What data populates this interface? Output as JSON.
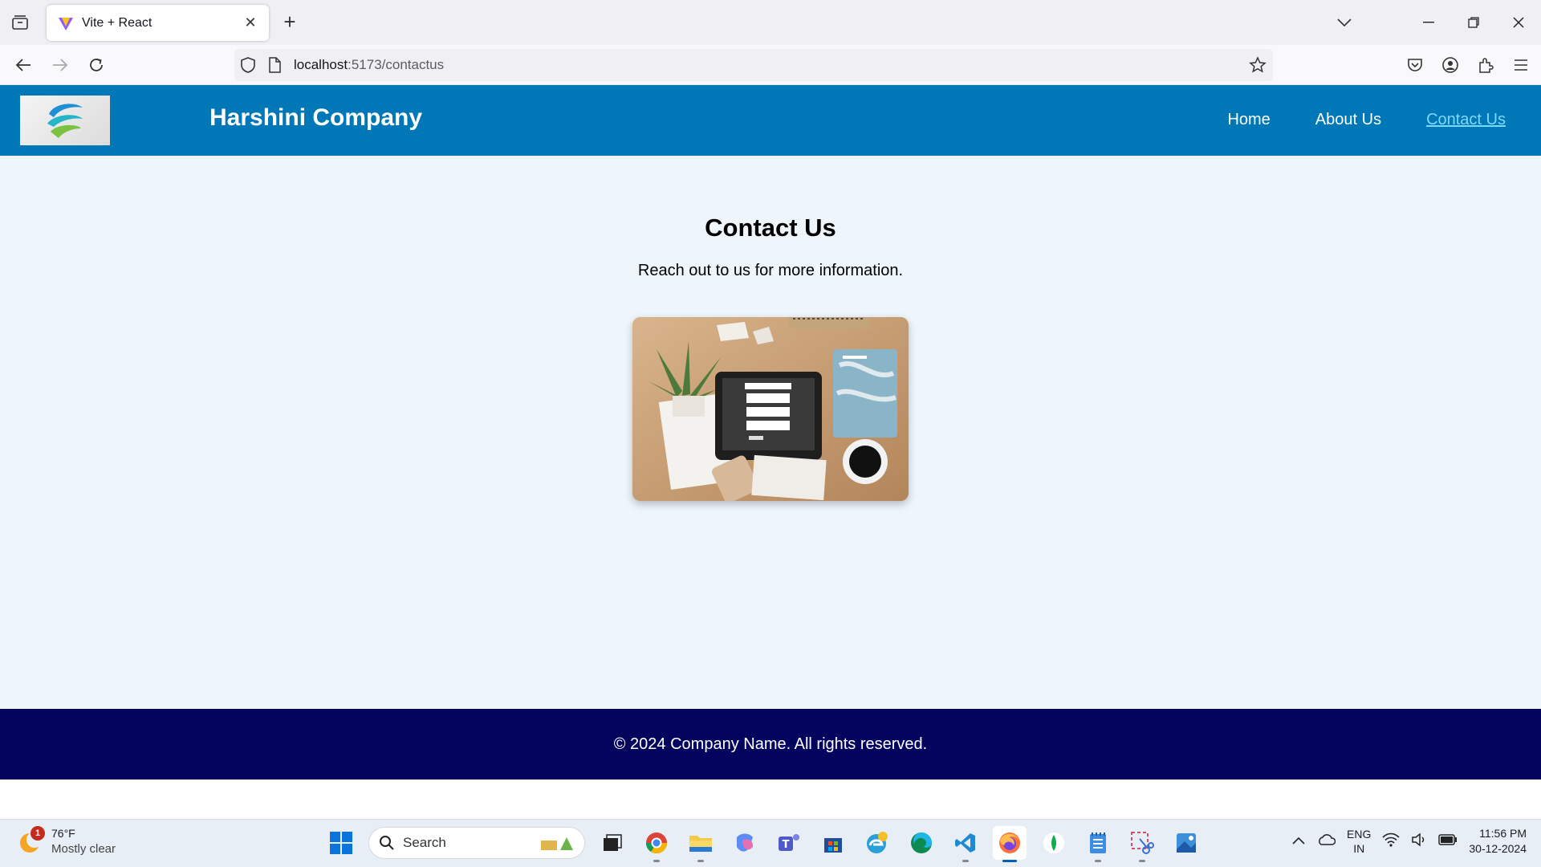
{
  "browser": {
    "tab_title": "Vite + React",
    "url_host": "localhost",
    "url_path": ":5173/contactus"
  },
  "site": {
    "brand": "Harshini Company",
    "nav": [
      {
        "label": "Home"
      },
      {
        "label": "About Us"
      },
      {
        "label": "Contact Us",
        "active": true
      }
    ],
    "title": "Contact Us",
    "subtitle": "Reach out to us for more information.",
    "footer": "© 2024 Company Name. All rights reserved.",
    "colors": {
      "header": "#0077b6",
      "footer": "#03045e",
      "main_bg": "#eef6fc",
      "active_link": "#7fd8ff"
    }
  },
  "taskbar": {
    "weather_temp": "76°F",
    "weather_desc": "Mostly clear",
    "weather_badge": "1",
    "search_label": "Search",
    "lang_top": "ENG",
    "lang_bottom": "IN",
    "time": "11:56 PM",
    "date": "30-12-2024"
  }
}
